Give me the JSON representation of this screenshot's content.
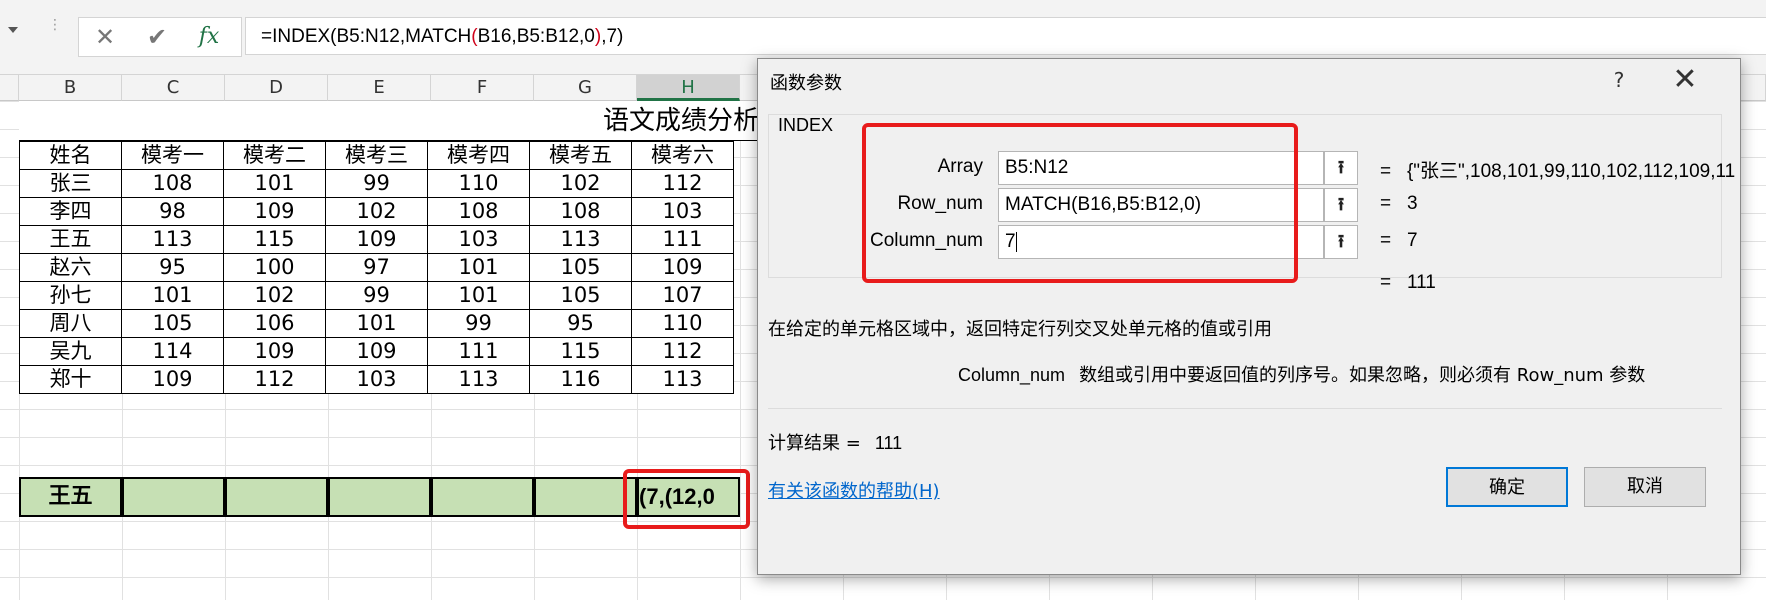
{
  "formula_bar": {
    "formula_parts": [
      "=INDEX(B5:N12,MATCH",
      "(",
      "B16,B5:B12,0",
      ")",
      ",7)"
    ],
    "cancel_icon": "close-icon",
    "enter_icon": "check-icon",
    "insert_function_label": "fx"
  },
  "columns": [
    "B",
    "C",
    "D",
    "E",
    "F",
    "G",
    "H"
  ],
  "sheet": {
    "title": "语文成绩分析",
    "headers": [
      "姓名",
      "模考一",
      "模考二",
      "模考三",
      "模考四",
      "模考五",
      "模考六"
    ],
    "rows": [
      [
        "张三",
        "108",
        "101",
        "99",
        "110",
        "102",
        "112"
      ],
      [
        "李四",
        "98",
        "109",
        "102",
        "108",
        "108",
        "103"
      ],
      [
        "王五",
        "113",
        "115",
        "109",
        "103",
        "113",
        "111"
      ],
      [
        "赵六",
        "95",
        "100",
        "97",
        "101",
        "105",
        "109"
      ],
      [
        "孙七",
        "101",
        "102",
        "99",
        "101",
        "105",
        "107"
      ],
      [
        "周八",
        "105",
        "106",
        "101",
        "99",
        "95",
        "110"
      ],
      [
        "吴九",
        "114",
        "109",
        "109",
        "111",
        "115",
        "112"
      ],
      [
        "郑十",
        "109",
        "112",
        "103",
        "113",
        "116",
        "113"
      ]
    ],
    "lookup_name": "王五",
    "editing_cell_text": "12,0),7)"
  },
  "dialog": {
    "title": "函数参数",
    "help_label": "?",
    "function_name": "INDEX",
    "args": [
      {
        "label": "Array",
        "value": "B5:N12",
        "result": "{\"张三\",108,101,99,110,102,112,109,11"
      },
      {
        "label": "Row_num",
        "value": "MATCH(B16,B5:B12,0)",
        "result": "3"
      },
      {
        "label": "Column_num",
        "value": "7",
        "result": "7"
      }
    ],
    "overall_result": "111",
    "description": "在给定的单元格区域中，返回特定行列交叉处单元格的值或引用",
    "arg_help_name": "Column_num",
    "arg_help_text": "数组或引用中要返回值的列序号。如果忽略，则必须有 Row_num 参数",
    "calc_label": "计算结果 =",
    "calc_value": "111",
    "help_link": "有关该函数的帮助(H)",
    "ok_label": "确定",
    "cancel_label": "取消"
  }
}
